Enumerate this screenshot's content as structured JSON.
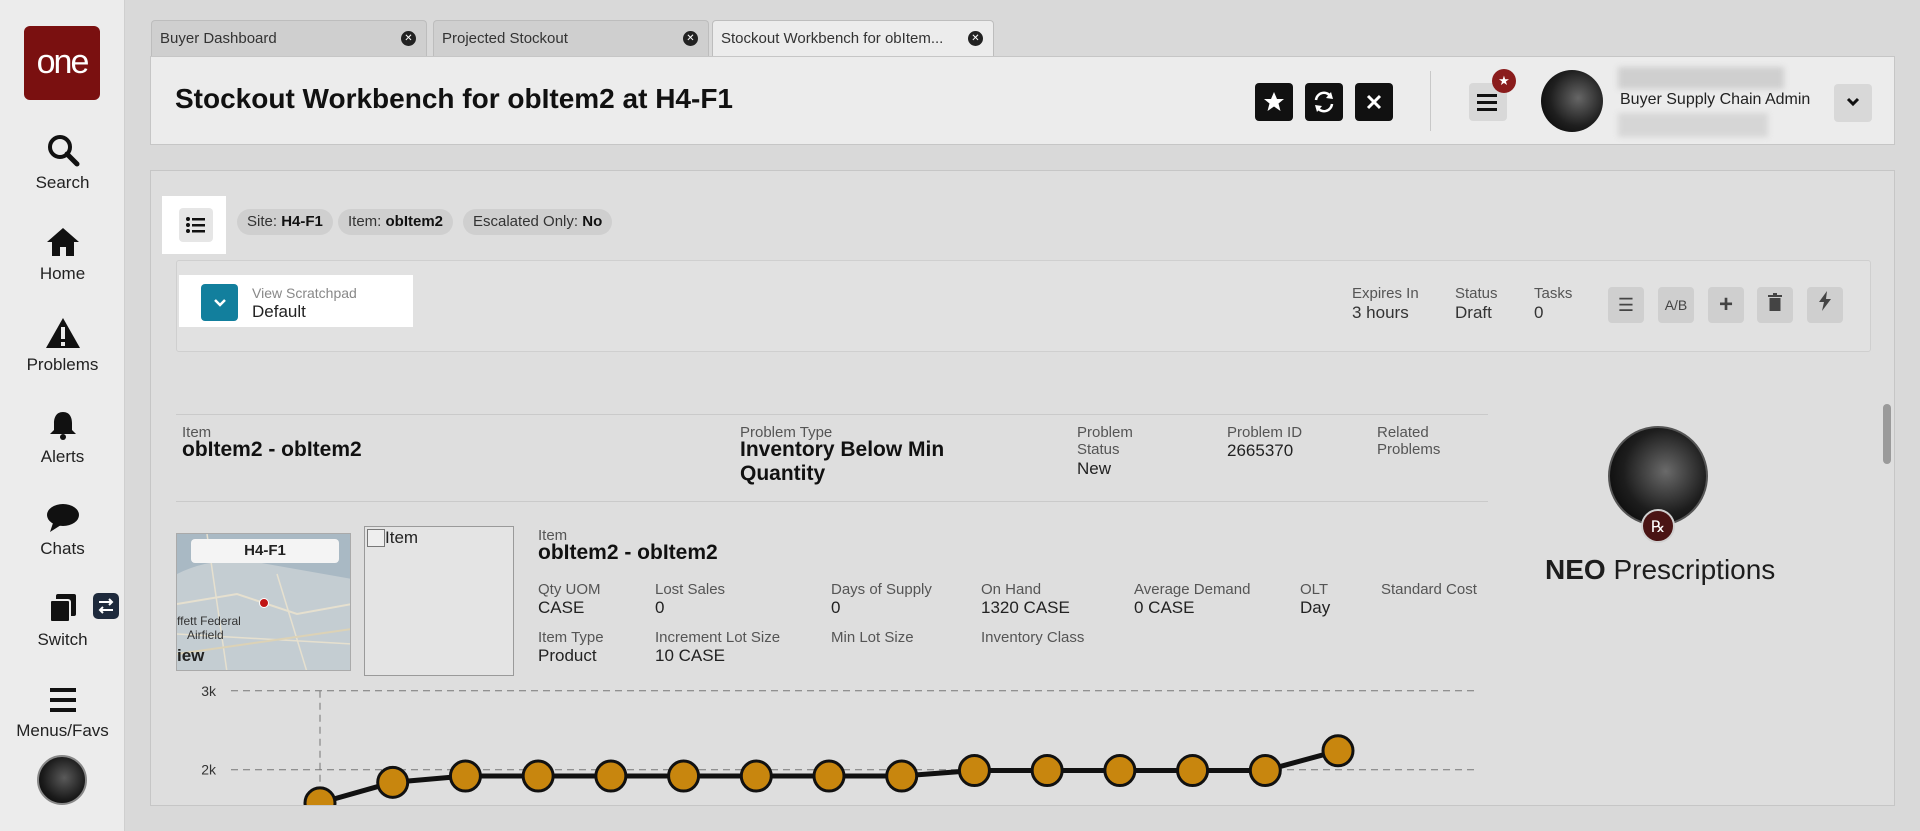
{
  "sidebar": {
    "logo": "one",
    "items": [
      {
        "label": "Search",
        "icon": "search-icon"
      },
      {
        "label": "Home",
        "icon": "home-icon"
      },
      {
        "label": "Problems",
        "icon": "warning-icon"
      },
      {
        "label": "Alerts",
        "icon": "bell-icon"
      },
      {
        "label": "Chats",
        "icon": "chat-icon"
      },
      {
        "label": "Switch",
        "icon": "switch-icon"
      },
      {
        "label": "Menus/Favs",
        "icon": "menu-icon"
      }
    ]
  },
  "tabs": [
    {
      "label": "Buyer Dashboard"
    },
    {
      "label": "Projected Stockout"
    },
    {
      "label": "Stockout Workbench for obItem..."
    }
  ],
  "header": {
    "title": "Stockout Workbench for obItem2 at H4-F1",
    "user_role": "Buyer Supply Chain Admin"
  },
  "filters": [
    {
      "label": "Site:",
      "value": "H4-F1"
    },
    {
      "label": "Item:",
      "value": "obItem2"
    },
    {
      "label": "Escalated Only:",
      "value": "No"
    }
  ],
  "scratchpad": {
    "label": "View Scratchpad",
    "value": "Default",
    "expires_label": "Expires In",
    "expires_value": "3 hours",
    "status_label": "Status",
    "status_value": "Draft",
    "tasks_label": "Tasks",
    "tasks_value": "0"
  },
  "problem": {
    "item_label": "Item",
    "item_value": "obItem2 - obItem2",
    "type_label": "Problem Type",
    "type_value_line1": "Inventory Below Min",
    "type_value_line2": "Quantity",
    "status_label_line1": "Problem",
    "status_label_line2": "Status",
    "status_value": "New",
    "id_label": "Problem ID",
    "id_value": "2665370",
    "related_label_line1": "Related",
    "related_label_line2": "Problems"
  },
  "map": {
    "site": "H4-F1",
    "place_line1": "ffett Federal",
    "place_line2": "Airfield",
    "view_label": "iew"
  },
  "item_image": {
    "label": "Item"
  },
  "item_details": {
    "item_label": "Item",
    "item_value": "obItem2 - obItem2",
    "fields": [
      {
        "label": "Qty UOM",
        "value": "CASE"
      },
      {
        "label": "Lost Sales",
        "value": "0"
      },
      {
        "label": "Days of Supply",
        "value": "0"
      },
      {
        "label": "On Hand",
        "value": "1320 CASE"
      },
      {
        "label": "Average Demand",
        "value": "0 CASE"
      },
      {
        "label": "OLT",
        "value": "Day"
      },
      {
        "label": "Standard Cost",
        "value": ""
      },
      {
        "label": "Item Type",
        "value": "Product"
      },
      {
        "label": "Increment Lot Size",
        "value": "10 CASE"
      },
      {
        "label": "Min Lot Size",
        "value": ""
      },
      {
        "label": "Inventory Class",
        "value": ""
      }
    ]
  },
  "chart_data": {
    "type": "line",
    "y_ticks": [
      "3k",
      "2k"
    ],
    "ylim": [
      1300,
      3200
    ],
    "grid": true,
    "series_color": "#c8860e",
    "values": [
      1580,
      1840,
      1920,
      1920,
      1920,
      1920,
      1920,
      1920,
      1920,
      1990,
      1990,
      1990,
      1990,
      1990,
      2240
    ]
  },
  "neo": {
    "brand": "NEO",
    "title": "Prescriptions",
    "rx": "℞"
  },
  "colors": {
    "brand": "#7a1010",
    "accent": "#127f9d",
    "badge": "#8a1c1c"
  }
}
